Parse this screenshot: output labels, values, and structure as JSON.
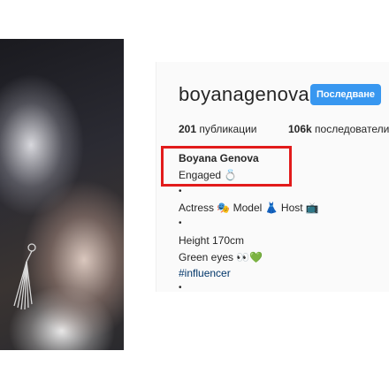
{
  "profile": {
    "username": "boyanagenova",
    "follow_button": "Последване",
    "stats": {
      "posts_count": "201",
      "posts_label": "публикации",
      "followers_count": "106k",
      "followers_label": "последователи"
    },
    "full_name": "Boyana Genova",
    "bio_lines": [
      "Engaged 💍",
      "•",
      "Actress 🎭 Model 👗 Host 📺",
      "•",
      "Height 170cm",
      "Green eyes 👀💚",
      "#influencer",
      "•"
    ]
  },
  "highlight_color": "#e21b1b",
  "accent_color": "#3897f0"
}
